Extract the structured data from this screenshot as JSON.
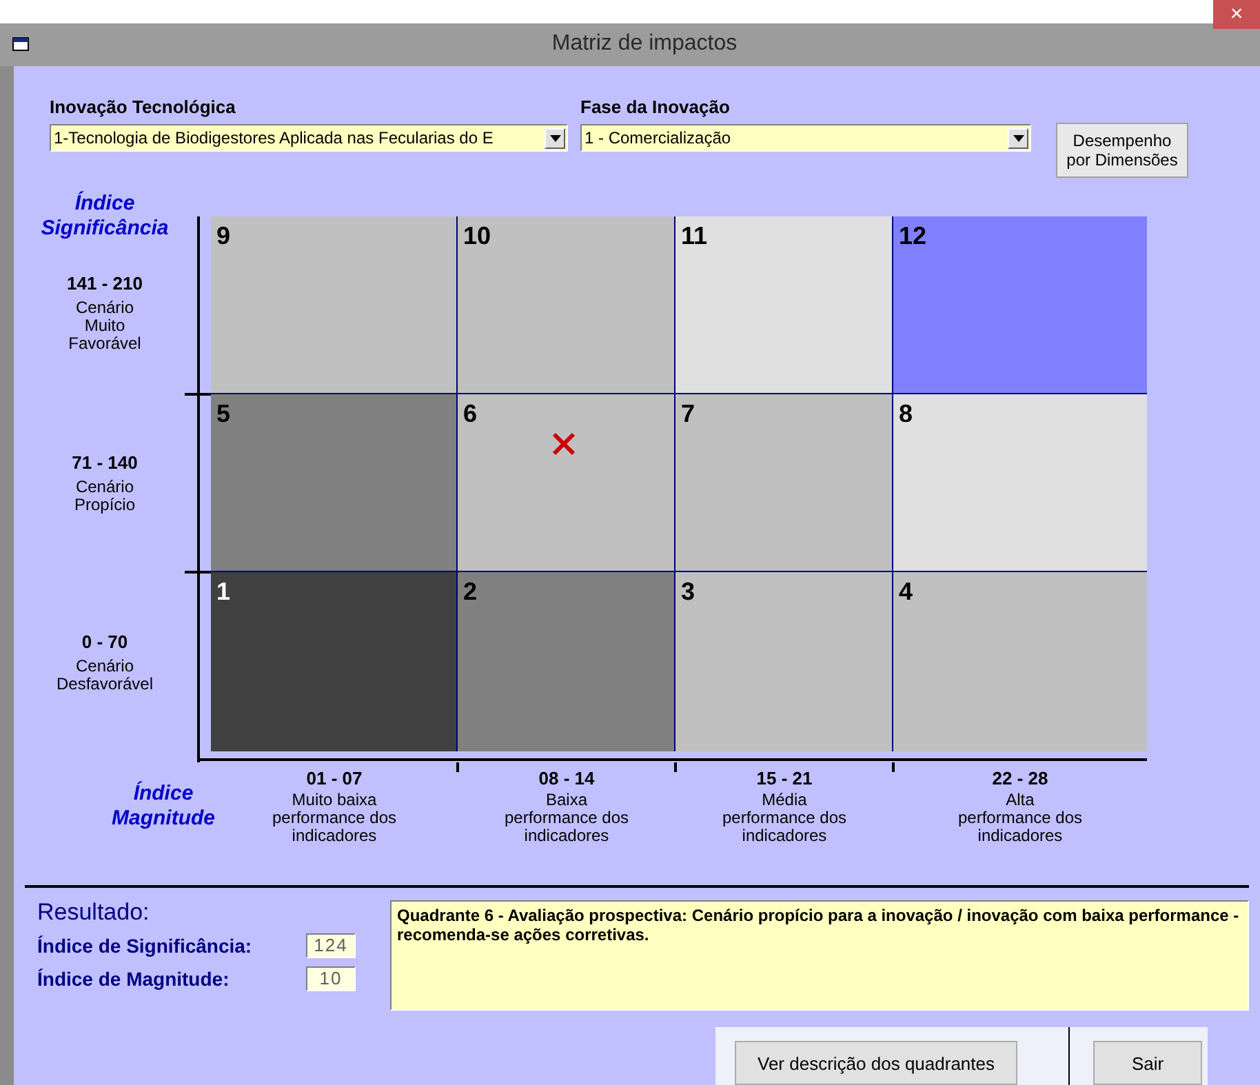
{
  "window": {
    "title": "Matriz de impactos",
    "close": "×"
  },
  "inputs": [
    {
      "label": "Inovação Tecnológica",
      "value": "1-Tecnologia de Biodigestores Aplicada nas Fecularias do E"
    },
    {
      "label": "Fase da Inovação",
      "value": "1 - Comercialização"
    }
  ],
  "dimensions_button": "Desempenho\npor Dimensões",
  "y_axis": {
    "title": "Índice\nSignificância",
    "rows": [
      {
        "range": "141 - 210",
        "text": "Cenário\nMuito\nFavorável"
      },
      {
        "range": "71 - 140",
        "text": "Cenário\nPropício"
      },
      {
        "range": "0 - 70",
        "text": "Cenário\nDesfavorável"
      }
    ]
  },
  "x_axis": {
    "title": "Índice\nMagnitude",
    "columns": [
      {
        "range": "01 - 07",
        "text": "Muito baixa\nperformance dos\nindicadores"
      },
      {
        "range": "08 - 14",
        "text": "Baixa\nperformance dos\nindicadores"
      },
      {
        "range": "15 - 21",
        "text": "Média\nperformance dos\nindicadores"
      },
      {
        "range": "22 - 28",
        "text": "Alta\nperformance dos\nindicadores"
      }
    ]
  },
  "cells": [
    {
      "number": "9",
      "color": "#c0c0c0",
      "marked": false
    },
    {
      "number": "10",
      "color": "#c0c0c0",
      "marked": false
    },
    {
      "number": "11",
      "color": "#e0e0e0",
      "marked": false
    },
    {
      "number": "12",
      "color": "#8080ff",
      "marked": false
    },
    {
      "number": "5",
      "color": "#808080",
      "marked": false
    },
    {
      "number": "6",
      "color": "#c0c0c0",
      "marked": true
    },
    {
      "number": "7",
      "color": "#c0c0c0",
      "marked": false
    },
    {
      "number": "8",
      "color": "#e0e0e0",
      "marked": false
    },
    {
      "number": "1",
      "color": "#404040",
      "marked": false
    },
    {
      "number": "2",
      "color": "#808080",
      "marked": false
    },
    {
      "number": "3",
      "color": "#c0c0c0",
      "marked": false
    },
    {
      "number": "4",
      "color": "#c0c0c0",
      "marked": false
    }
  ],
  "result": {
    "title": "Resultado:",
    "fields": [
      {
        "label": "Índice de Significância:",
        "value": "124"
      },
      {
        "label": "Índice de Magnitude:",
        "value": "10"
      }
    ],
    "description": "Quadrante 6 - Avaliação prospectiva: Cenário propício para a inovação / inovação com baixa performance - recomenda-se ações corretivas."
  },
  "buttons": [
    "Ver descrição dos quadrantes",
    "Sair"
  ]
}
